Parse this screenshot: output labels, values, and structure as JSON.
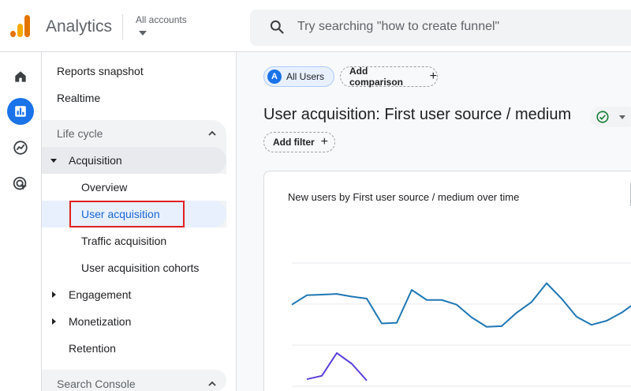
{
  "header": {
    "app_title": "Analytics",
    "account_label": "All accounts",
    "search_placeholder": "Try searching \"how to create funnel\""
  },
  "rail": {
    "items": [
      {
        "name": "home-icon"
      },
      {
        "name": "reports-icon",
        "active": true
      },
      {
        "name": "explore-icon"
      },
      {
        "name": "advertising-icon"
      }
    ]
  },
  "nav": {
    "reports_snapshot": "Reports snapshot",
    "realtime": "Realtime",
    "life_cycle": {
      "title": "Life cycle",
      "acquisition": "Acquisition",
      "overview": "Overview",
      "user_acquisition": "User acquisition",
      "traffic_acquisition": "Traffic acquisition",
      "user_acquisition_cohorts": "User acquisition cohorts",
      "engagement": "Engagement",
      "monetization": "Monetization",
      "retention": "Retention"
    },
    "search_console": "Search Console"
  },
  "main": {
    "chip_users_letter": "A",
    "chip_users": "All Users",
    "add_comparison": "Add comparison",
    "report_title": "User acquisition: First user source / medium",
    "add_filter": "Add filter",
    "chart_title": "New users by First user source / medium over time"
  },
  "colors": {
    "accent": "#1a73e8",
    "series1": "#1f77b4",
    "series2": "#5b3fd6",
    "highlight": "#e02020"
  },
  "chart_data": {
    "type": "line",
    "title": "New users by First user source / medium over time",
    "xlabel": "",
    "ylabel": "",
    "grid": true,
    "series": [
      {
        "values": [
          78,
          92,
          93,
          94,
          90,
          87,
          50,
          51,
          100,
          85,
          85,
          78,
          59,
          45,
          46,
          66,
          82,
          110,
          87,
          60,
          48,
          54,
          66,
          82,
          92
        ]
      },
      {
        "values": [
          -33,
          -28,
          6,
          -10,
          -35
        ]
      }
    ]
  }
}
